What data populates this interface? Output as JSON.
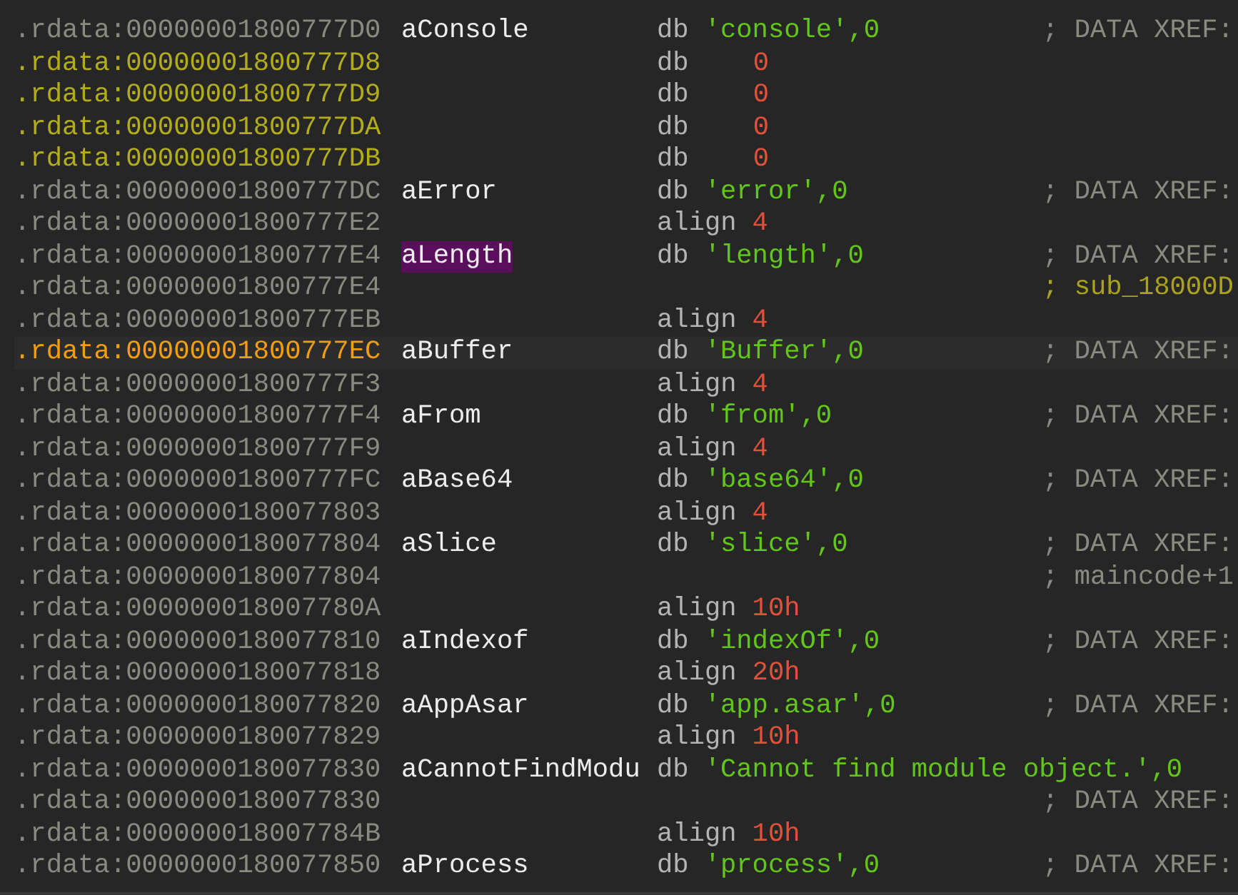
{
  "rows": [
    {
      "address": ".rdata:00000001800777D0",
      "selected": false,
      "unexplored": false,
      "label": "aConsole",
      "highlighted": false,
      "mnemonic": "db",
      "operand": {
        "kind": "string",
        "text": "'console',0"
      },
      "comment": {
        "kind": "xref",
        "text": "; DATA XREF:"
      }
    },
    {
      "address": ".rdata:00000001800777D8",
      "selected": false,
      "unexplored": true,
      "mnemonic": "db",
      "operand": {
        "kind": "byte",
        "text": "0"
      }
    },
    {
      "address": ".rdata:00000001800777D9",
      "selected": false,
      "unexplored": true,
      "mnemonic": "db",
      "operand": {
        "kind": "byte",
        "text": "0"
      }
    },
    {
      "address": ".rdata:00000001800777DA",
      "selected": false,
      "unexplored": true,
      "mnemonic": "db",
      "operand": {
        "kind": "byte",
        "text": "0"
      }
    },
    {
      "address": ".rdata:00000001800777DB",
      "selected": false,
      "unexplored": true,
      "mnemonic": "db",
      "operand": {
        "kind": "byte",
        "text": "0"
      }
    },
    {
      "address": ".rdata:00000001800777DC",
      "selected": false,
      "unexplored": false,
      "label": "aError",
      "highlighted": false,
      "mnemonic": "db",
      "operand": {
        "kind": "string",
        "text": "'error',0"
      },
      "comment": {
        "kind": "xref",
        "text": "; DATA XREF:"
      }
    },
    {
      "address": ".rdata:00000001800777E2",
      "selected": false,
      "unexplored": false,
      "mnemonic": "align",
      "operand": {
        "kind": "number",
        "text": "4"
      }
    },
    {
      "address": ".rdata:00000001800777E4",
      "selected": false,
      "unexplored": false,
      "label": "aLength",
      "highlighted": true,
      "mnemonic": "db",
      "operand": {
        "kind": "string",
        "text": "'length',0"
      },
      "comment": {
        "kind": "xref",
        "text": "; DATA XREF:"
      }
    },
    {
      "address": ".rdata:00000001800777E4",
      "selected": false,
      "unexplored": false,
      "comment": {
        "kind": "symbol",
        "text": "; sub_18000D"
      }
    },
    {
      "address": ".rdata:00000001800777EB",
      "selected": false,
      "unexplored": false,
      "mnemonic": "align",
      "operand": {
        "kind": "number",
        "text": "4"
      }
    },
    {
      "address": ".rdata:00000001800777EC",
      "selected": true,
      "label": "aBuffer",
      "highlighted": false,
      "mnemonic": "db",
      "operand": {
        "kind": "string",
        "text": "'Buffer',0"
      },
      "comment": {
        "kind": "xref",
        "text": "; DATA XREF:"
      }
    },
    {
      "address": ".rdata:00000001800777F3",
      "selected": false,
      "unexplored": false,
      "mnemonic": "align",
      "operand": {
        "kind": "number",
        "text": "4"
      }
    },
    {
      "address": ".rdata:00000001800777F4",
      "selected": false,
      "unexplored": false,
      "label": "aFrom",
      "highlighted": false,
      "mnemonic": "db",
      "operand": {
        "kind": "string",
        "text": "'from',0"
      },
      "comment": {
        "kind": "xref",
        "text": "; DATA XREF:"
      }
    },
    {
      "address": ".rdata:00000001800777F9",
      "selected": false,
      "unexplored": false,
      "mnemonic": "align",
      "operand": {
        "kind": "number",
        "text": "4"
      }
    },
    {
      "address": ".rdata:00000001800777FC",
      "selected": false,
      "unexplored": false,
      "label": "aBase64",
      "highlighted": false,
      "mnemonic": "db",
      "operand": {
        "kind": "string",
        "text": "'base64',0"
      },
      "comment": {
        "kind": "xref",
        "text": "; DATA XREF:"
      }
    },
    {
      "address": ".rdata:0000000180077803",
      "selected": false,
      "unexplored": false,
      "mnemonic": "align",
      "operand": {
        "kind": "number",
        "text": "4"
      }
    },
    {
      "address": ".rdata:0000000180077804",
      "selected": false,
      "unexplored": false,
      "label": "aSlice",
      "highlighted": false,
      "mnemonic": "db",
      "operand": {
        "kind": "string",
        "text": "'slice',0"
      },
      "comment": {
        "kind": "xref",
        "text": "; DATA XREF:"
      }
    },
    {
      "address": ".rdata:0000000180077804",
      "selected": false,
      "unexplored": false,
      "comment": {
        "kind": "xref",
        "text": "; maincode+1"
      }
    },
    {
      "address": ".rdata:000000018007780A",
      "selected": false,
      "unexplored": false,
      "mnemonic": "align",
      "operand": {
        "kind": "number",
        "text": "10h"
      }
    },
    {
      "address": ".rdata:0000000180077810",
      "selected": false,
      "unexplored": false,
      "label": "aIndexof",
      "highlighted": false,
      "mnemonic": "db",
      "operand": {
        "kind": "string",
        "text": "'indexOf',0"
      },
      "comment": {
        "kind": "xref",
        "text": "; DATA XREF:"
      }
    },
    {
      "address": ".rdata:0000000180077818",
      "selected": false,
      "unexplored": false,
      "mnemonic": "align",
      "operand": {
        "kind": "number",
        "text": "20h"
      }
    },
    {
      "address": ".rdata:0000000180077820",
      "selected": false,
      "unexplored": false,
      "label": "aAppAsar",
      "highlighted": false,
      "mnemonic": "db",
      "operand": {
        "kind": "string",
        "text": "'app.asar',0"
      },
      "comment": {
        "kind": "xref",
        "text": "; DATA XREF:"
      }
    },
    {
      "address": ".rdata:0000000180077829",
      "selected": false,
      "unexplored": false,
      "mnemonic": "align",
      "operand": {
        "kind": "number",
        "text": "10h"
      }
    },
    {
      "address": ".rdata:0000000180077830",
      "selected": false,
      "unexplored": false,
      "label": "aCannotFindModu",
      "highlighted": false,
      "mnemonic": "db",
      "operand": {
        "kind": "string",
        "text": "'Cannot find module object.',0"
      }
    },
    {
      "address": ".rdata:0000000180077830",
      "selected": false,
      "unexplored": false,
      "comment": {
        "kind": "xref",
        "text": "; DATA XREF:"
      }
    },
    {
      "address": ".rdata:000000018007784B",
      "selected": false,
      "unexplored": false,
      "mnemonic": "align",
      "operand": {
        "kind": "number",
        "text": "10h"
      }
    },
    {
      "address": ".rdata:0000000180077850",
      "selected": false,
      "unexplored": false,
      "label": "aProcess",
      "highlighted": false,
      "mnemonic": "db",
      "operand": {
        "kind": "string",
        "text": "'process',0"
      },
      "comment": {
        "kind": "xref",
        "text": "; DATA XREF:"
      }
    }
  ]
}
